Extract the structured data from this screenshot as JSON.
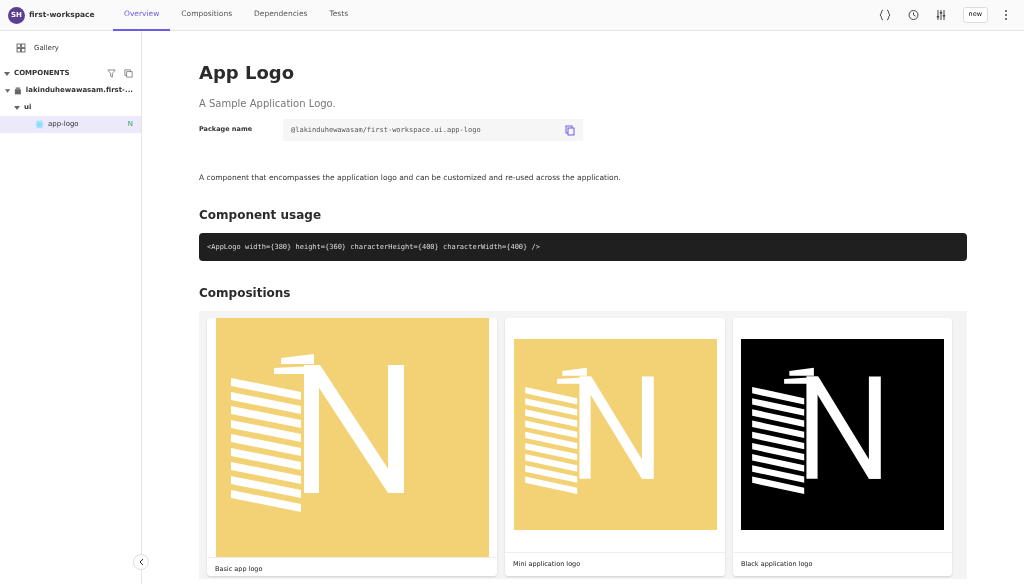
{
  "workspace": {
    "initials": "SH",
    "name": "first-workspace"
  },
  "tabs": [
    {
      "label": "Overview",
      "selected": true
    },
    {
      "label": "Compositions",
      "selected": false
    },
    {
      "label": "Dependencies",
      "selected": false
    },
    {
      "label": "Tests",
      "selected": false
    }
  ],
  "toolbar": {
    "version": "new"
  },
  "sidebar": {
    "gallery": "Gallery",
    "section": "COMPONENTS",
    "tree": [
      {
        "label": "lakinduhewawasam.first-...",
        "kind": "scope",
        "expanded": true,
        "selected": false,
        "children": [
          {
            "label": "ui",
            "kind": "namespace",
            "expanded": true,
            "selected": false,
            "children": [
              {
                "label": "app-logo",
                "kind": "component",
                "badge": "N",
                "selected": true
              }
            ]
          }
        ]
      }
    ]
  },
  "component": {
    "title": "App Logo",
    "subtitle": "A Sample Application Logo.",
    "package_label": "Package name",
    "package_name": "@lakinduhewawasam/first-workspace.ui.app-logo",
    "description": "A component that encompasses the application logo and can be customized and re-used across the application.",
    "usage_heading": "Component usage",
    "usage_code": "<AppLogo width={380} height={360} characterHeight={400} characterWidth={400} />"
  },
  "compositions": {
    "heading": "Compositions",
    "items": [
      {
        "label": "Basic app logo",
        "color": "#f2d275",
        "kind": "large"
      },
      {
        "label": "Mini application logo",
        "color": "#f2d275",
        "kind": "small"
      },
      {
        "label": "Black application logo",
        "color": "#000000",
        "kind": "small"
      }
    ]
  }
}
